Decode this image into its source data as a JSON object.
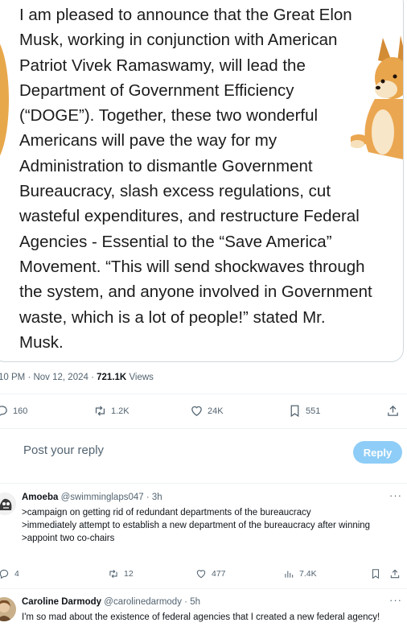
{
  "quote_card": {
    "text": "I am pleased to announce that the Great Elon Musk, working in conjunction with American Patriot Vivek Ramaswamy, will lead the Department of Government Efficiency (“DOGE”). Together, these two wonderful Americans will pave the way for my Administration to dismantle Government Bureaucracy, slash excess regulations, cut wasteful expenditures, and restructure Federal Agencies - Essential to the “Save America” Movement. “This will send shockwaves through the system, and anyone involved in Government waste, which is a lot of people!” stated Mr. Musk."
  },
  "post_meta": {
    "time": "10 PM",
    "date": "Nov 12, 2024",
    "views_count": "721.1K",
    "views_label": "Views"
  },
  "post_actions": {
    "replies": "160",
    "reposts": "1.2K",
    "likes": "24K",
    "bookmarks": "551"
  },
  "reply_box": {
    "placeholder": "Post your reply",
    "button_label": "Reply"
  },
  "replies": [
    {
      "name": "Amoeba",
      "handle": "@swimminglaps047",
      "time": "3h",
      "lines": [
        ">campaign on getting rid of redundant departments of the bureaucracy",
        ">immediately attempt to establish a new department of the bureaucracy after winning",
        ">appoint two co-chairs"
      ],
      "replies": "4",
      "reposts": "12",
      "likes": "477",
      "views": "7.4K"
    },
    {
      "name": "Caroline Darmody",
      "handle": "@carolinedarmody",
      "time": "5h",
      "lines": [
        "I'm so mad about the existence of federal agencies that I created a new federal agency!"
      ]
    }
  ],
  "icons": {
    "reply": "speech-bubble-icon",
    "repost": "repost-arrows-icon",
    "like": "heart-icon",
    "bookmark": "bookmark-icon",
    "share": "share-upload-icon",
    "views": "bar-chart-icon",
    "more": "more-dots-icon"
  },
  "colors": {
    "text": "#0f1419",
    "secondary": "#536471",
    "reply_button": "#8ecdf7",
    "border": "#cfd9de"
  }
}
